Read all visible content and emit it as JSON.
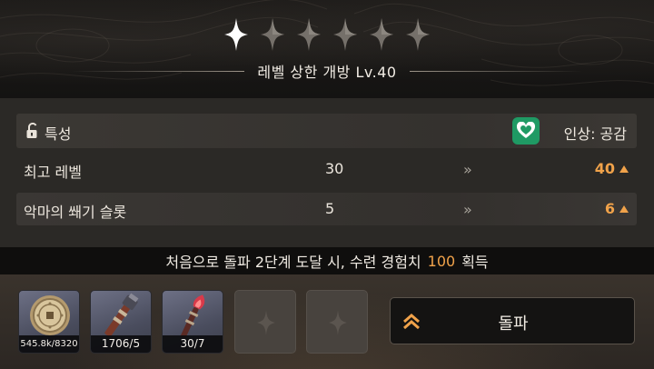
{
  "header": {
    "stars_total": 6,
    "stars_filled": 1,
    "title": "레벨 상한 개방 Lv.40"
  },
  "traits": {
    "label": "특성",
    "lock_icon": "unlocked-lock-icon",
    "badge_icon": "heart-icon",
    "badge_color": "#1f9a64",
    "value": "인상: 공감"
  },
  "stats": [
    {
      "name": "최고 레벨",
      "current": "30",
      "arrow": "»",
      "next": "40"
    },
    {
      "name": "악마의 쐐기 슬롯",
      "current": "5",
      "arrow": "»",
      "next": "6"
    }
  ],
  "info": {
    "prefix": "처음으로 돌파 2단계 도달 시, 수련 경험치",
    "amount": "100",
    "suffix": "획득"
  },
  "materials": [
    {
      "icon": "coin-icon",
      "count": "545.8k/8320"
    },
    {
      "icon": "torch-icon",
      "count": "1706/5"
    },
    {
      "icon": "flame-torch-icon",
      "count": "30/7"
    }
  ],
  "empty_slots": 2,
  "break_button": {
    "label": "돌파",
    "icon": "double-chevron-up-icon"
  },
  "colors": {
    "accent": "#f0a24a",
    "badge": "#1f9a64"
  }
}
